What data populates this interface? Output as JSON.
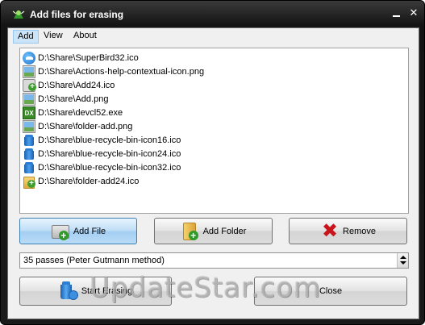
{
  "window": {
    "title": "Add files for erasing",
    "minimize_glyph": "",
    "close_glyph": "✕"
  },
  "menu": {
    "items": [
      {
        "label": "Add",
        "active": true
      },
      {
        "label": "View",
        "active": false
      },
      {
        "label": "About",
        "active": false
      }
    ]
  },
  "files": [
    {
      "path": "D:\\Share\\SuperBird32.ico",
      "icon": "superbird-icon"
    },
    {
      "path": "D:\\Share\\Actions-help-contextual-icon.png",
      "icon": "image-file-icon"
    },
    {
      "path": "D:\\Share\\Add24.ico",
      "icon": "add-icon"
    },
    {
      "path": "D:\\Share\\Add.png",
      "icon": "image-file-icon"
    },
    {
      "path": "D:\\Share\\devcl52.exe",
      "icon": "dx-executable-icon"
    },
    {
      "path": "D:\\Share\\folder-add.png",
      "icon": "image-file-icon"
    },
    {
      "path": "D:\\Share\\blue-recycle-bin-icon16.ico",
      "icon": "recycle-bin-icon"
    },
    {
      "path": "D:\\Share\\blue-recycle-bin-icon24.ico",
      "icon": "recycle-bin-icon"
    },
    {
      "path": "D:\\Share\\blue-recycle-bin-icon32.ico",
      "icon": "recycle-bin-icon"
    },
    {
      "path": "D:\\Share\\folder-add24.ico",
      "icon": "folder-add-icon"
    }
  ],
  "buttons": {
    "add_file": "Add File",
    "add_folder": "Add Folder",
    "remove": "Remove",
    "start_erasing": "Start Erasing",
    "close": "Close"
  },
  "method_select": {
    "selected": "35 passes (Peter Gutmann method)"
  },
  "watermark": "UpdateStar.com",
  "colors": {
    "titlebar": "#141414",
    "primary_button": "#a4cef2",
    "remove_icon": "#c8141a"
  }
}
